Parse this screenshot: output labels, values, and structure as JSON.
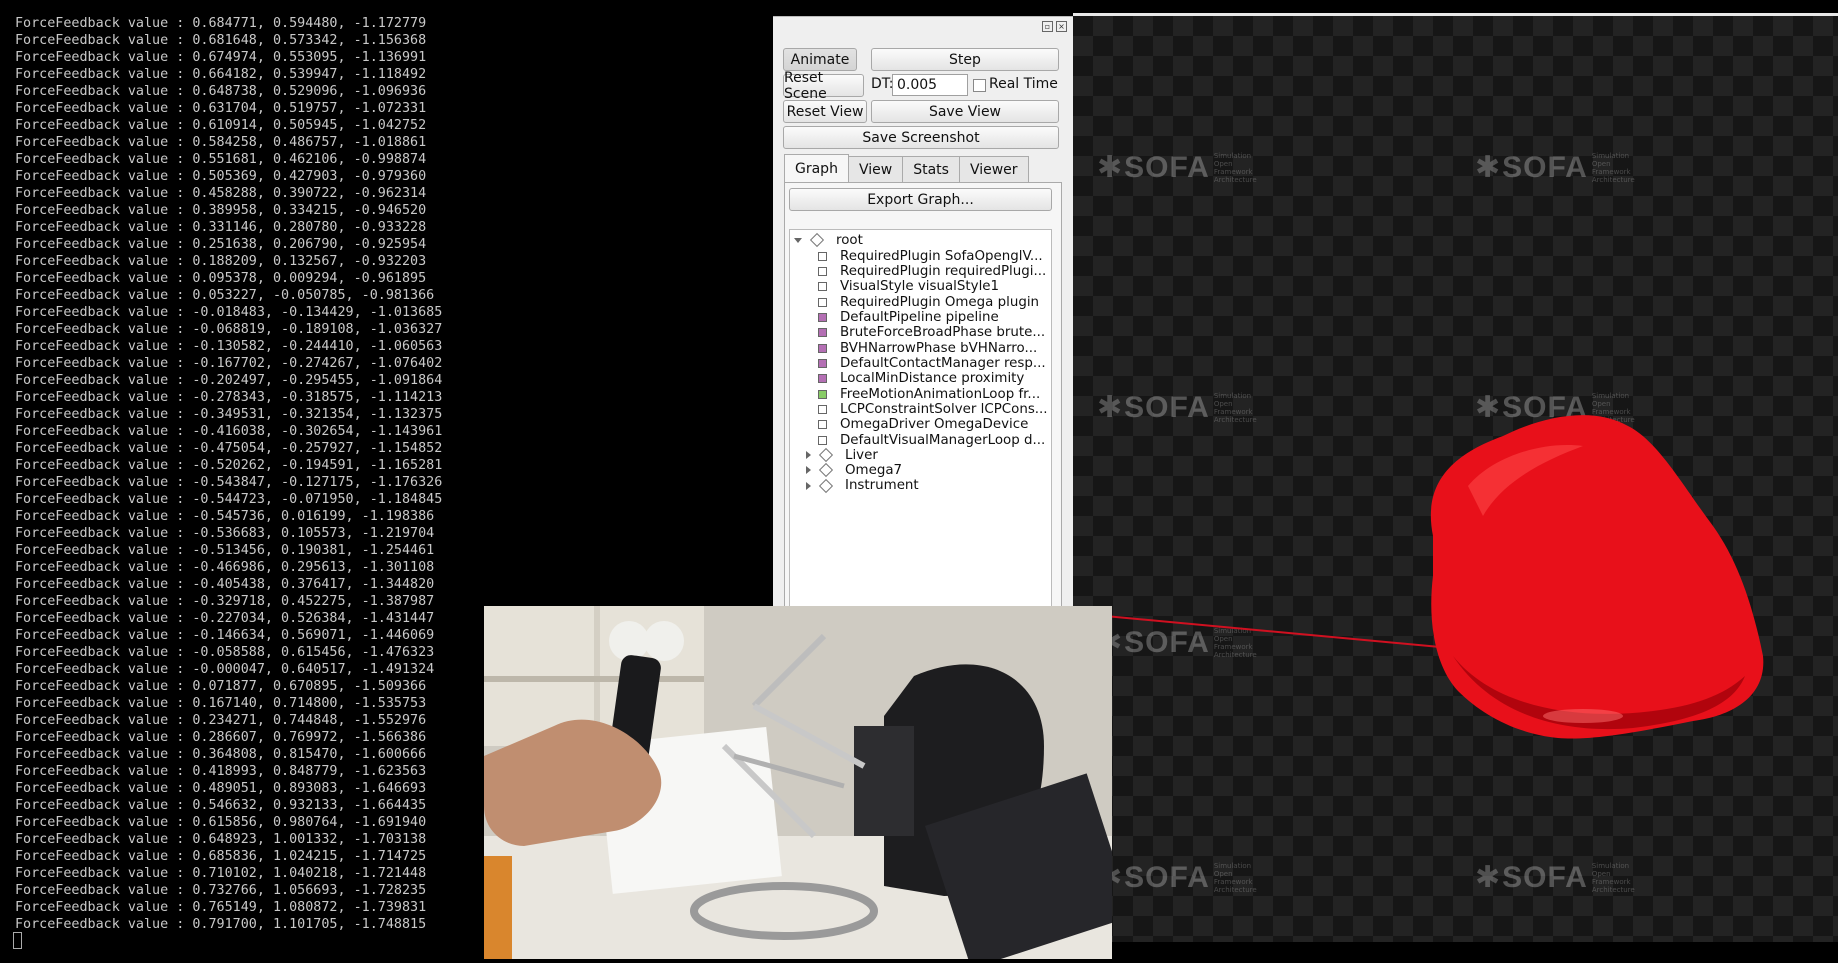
{
  "terminal": {
    "lines": [
      "ForceFeedback value : 0.684771, 0.594480, -1.172779",
      "ForceFeedback value : 0.681648, 0.573342, -1.156368",
      "ForceFeedback value : 0.674974, 0.553095, -1.136991",
      "ForceFeedback value : 0.664182, 0.539947, -1.118492",
      "ForceFeedback value : 0.648738, 0.529096, -1.096936",
      "ForceFeedback value : 0.631704, 0.519757, -1.072331",
      "ForceFeedback value : 0.610914, 0.505945, -1.042752",
      "ForceFeedback value : 0.584258, 0.486757, -1.018861",
      "ForceFeedback value : 0.551681, 0.462106, -0.998874",
      "ForceFeedback value : 0.505369, 0.427903, -0.979360",
      "ForceFeedback value : 0.458288, 0.390722, -0.962314",
      "ForceFeedback value : 0.389958, 0.334215, -0.946520",
      "ForceFeedback value : 0.331146, 0.280780, -0.933228",
      "ForceFeedback value : 0.251638, 0.206790, -0.925954",
      "ForceFeedback value : 0.188209, 0.132567, -0.932203",
      "ForceFeedback value : 0.095378, 0.009294, -0.961895",
      "ForceFeedback value : 0.053227, -0.050785, -0.981366",
      "ForceFeedback value : -0.018483, -0.134429, -1.013685",
      "ForceFeedback value : -0.068819, -0.189108, -1.036327",
      "ForceFeedback value : -0.130582, -0.244410, -1.060563",
      "ForceFeedback value : -0.167702, -0.274267, -1.076402",
      "ForceFeedback value : -0.202497, -0.295455, -1.091864",
      "ForceFeedback value : -0.278343, -0.318575, -1.114213",
      "ForceFeedback value : -0.349531, -0.321354, -1.132375",
      "ForceFeedback value : -0.416038, -0.302654, -1.143961",
      "ForceFeedback value : -0.475054, -0.257927, -1.154852",
      "ForceFeedback value : -0.520262, -0.194591, -1.165281",
      "ForceFeedback value : -0.543847, -0.127175, -1.176326",
      "ForceFeedback value : -0.544723, -0.071950, -1.184845",
      "ForceFeedback value : -0.545736, 0.016199, -1.198386",
      "ForceFeedback value : -0.536683, 0.105573, -1.219704",
      "ForceFeedback value : -0.513456, 0.190381, -1.254461",
      "ForceFeedback value : -0.466986, 0.295613, -1.301108",
      "ForceFeedback value : -0.405438, 0.376417, -1.344820",
      "ForceFeedback value : -0.329718, 0.452275, -1.387987",
      "ForceFeedback value : -0.227034, 0.526384, -1.431447",
      "ForceFeedback value : -0.146634, 0.569071, -1.446069",
      "ForceFeedback value : -0.058588, 0.615456, -1.476323",
      "ForceFeedback value : -0.000047, 0.640517, -1.491324",
      "ForceFeedback value : 0.071877, 0.670895, -1.509366",
      "ForceFeedback value : 0.167140, 0.714800, -1.535753",
      "ForceFeedback value : 0.234271, 0.744848, -1.552976",
      "ForceFeedback value : 0.286607, 0.769972, -1.566386",
      "ForceFeedback value : 0.364808, 0.815470, -1.600666",
      "ForceFeedback value : 0.418993, 0.848779, -1.623563",
      "ForceFeedback value : 0.489051, 0.893083, -1.646693",
      "ForceFeedback value : 0.546632, 0.932133, -1.664435",
      "ForceFeedback value : 0.615856, 0.980764, -1.691940",
      "ForceFeedback value : 0.648923, 1.001332, -1.703138",
      "ForceFeedback value : 0.685836, 1.024215, -1.714725",
      "ForceFeedback value : 0.710102, 1.040218, -1.721448",
      "ForceFeedback value : 0.732766, 1.056693, -1.728235",
      "ForceFeedback value : 0.765149, 1.080872, -1.739831",
      "ForceFeedback value : 0.791700, 1.101705, -1.748815"
    ]
  },
  "controls": {
    "animate": "Animate",
    "step": "Step",
    "reset_scene": "Reset Scene",
    "dt_label": "DT:",
    "dt_value": "0.005",
    "real_time": "Real Time",
    "reset_view": "Reset View",
    "save_view": "Save View",
    "save_screenshot": "Save Screenshot"
  },
  "tabs": [
    "Graph",
    "View",
    "Stats",
    "Viewer"
  ],
  "export_graph": "Export Graph...",
  "tree": {
    "root": "root",
    "components": [
      {
        "label": "RequiredPlugin SofaOpenglV...",
        "color": "#ffffff"
      },
      {
        "label": "RequiredPlugin requiredPlugi...",
        "color": "#ffffff"
      },
      {
        "label": "VisualStyle visualStyle1",
        "color": "#ffffff"
      },
      {
        "label": "RequiredPlugin Omega plugin",
        "color": "#ffffff"
      },
      {
        "label": "DefaultPipeline pipeline",
        "color": "#b46fb4"
      },
      {
        "label": "BruteForceBroadPhase brute...",
        "color": "#b46fb4"
      },
      {
        "label": "BVHNarrowPhase bVHNarro...",
        "color": "#b46fb4"
      },
      {
        "label": "DefaultContactManager resp...",
        "color": "#b46fb4"
      },
      {
        "label": "LocalMinDistance proximity",
        "color": "#b46fb4"
      },
      {
        "label": "FreeMotionAnimationLoop fr...",
        "color": "#88cc66"
      },
      {
        "label": "LCPConstraintSolver lCPCons...",
        "color": "#ffffff"
      },
      {
        "label": "OmegaDriver OmegaDevice",
        "color": "#ffffff"
      },
      {
        "label": "DefaultVisualManagerLoop d...",
        "color": "#ffffff"
      }
    ],
    "children": [
      "Liver",
      "Omega7",
      "Instrument"
    ]
  },
  "viewer": {
    "watermark": "SOFA",
    "watermark_sub": "Simulation Open Framework Architecture",
    "colors": {
      "liver": "#e8101a",
      "tool_line": "#d01020"
    }
  }
}
